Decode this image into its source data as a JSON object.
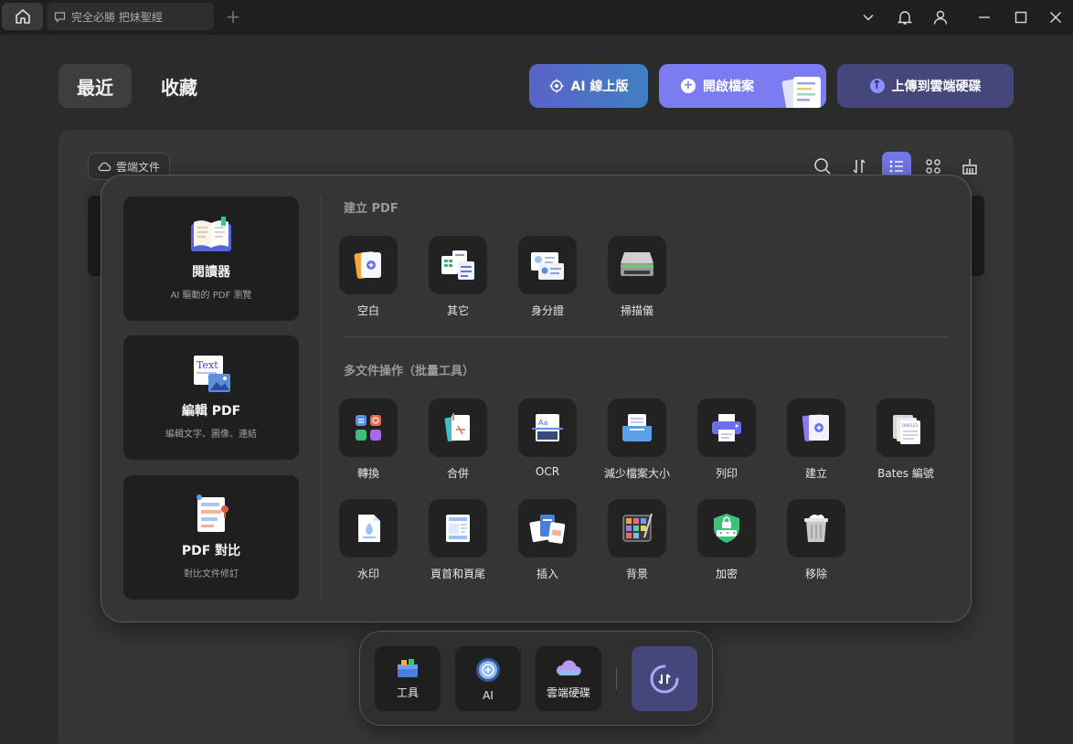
{
  "titlebar": {
    "tab_title": "完全必勝 把妹聖經",
    "new_tab": "+"
  },
  "header": {
    "tabs": [
      {
        "label": "最近",
        "active": true
      },
      {
        "label": "收藏",
        "active": false
      }
    ],
    "ai_button": "AI 線上版",
    "open_button": "開啟檔案",
    "upload_button": "上傳到雲端硬碟"
  },
  "panel": {
    "cloud_chip": "雲端文件"
  },
  "popup": {
    "features": [
      {
        "title": "閱讀器",
        "subtitle": "AI 驅動的 PDF 瀏覽"
      },
      {
        "title": "編輯 PDF",
        "subtitle": "編輯文字、圖像、連結"
      },
      {
        "title": "PDF 對比",
        "subtitle": "對比文件修訂"
      }
    ],
    "create_section": {
      "title": "建立 PDF",
      "items": [
        "空白",
        "其它",
        "身分證",
        "掃描儀"
      ]
    },
    "batch_section": {
      "title": "多文件操作（批量工具）",
      "items": [
        "轉換",
        "合併",
        "OCR",
        "減少檔案大小",
        "列印",
        "建立",
        "Bates 編號",
        "水印",
        "頁首和頁尾",
        "插入",
        "背景",
        "加密",
        "移除"
      ]
    }
  },
  "dock": {
    "items": [
      "工具",
      "AI",
      "雲端硬碟"
    ]
  },
  "colors": {
    "accent": "#7477e8",
    "ai_gradient_start": "#5a63c8",
    "ai_gradient_end": "#3f7fc2",
    "open_button": "#7b7cf2",
    "upload_button": "#45467a"
  }
}
